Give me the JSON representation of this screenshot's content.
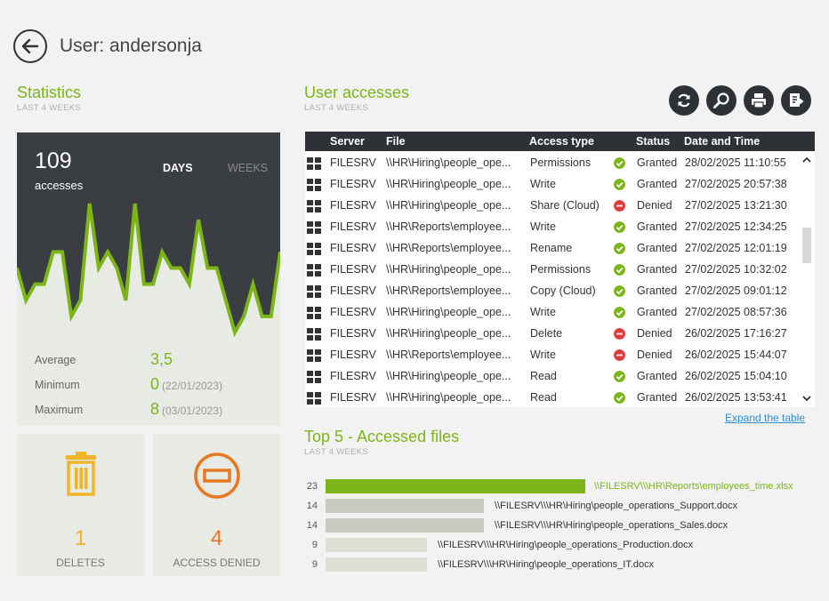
{
  "header": {
    "title": "User: andersonja"
  },
  "statistics": {
    "title": "Statistics",
    "subtitle": "LAST 4 WEEKS",
    "count": "109",
    "count_label": "accesses",
    "tab_days": "DAYS",
    "tab_weeks": "WEEKS",
    "average_label": "Average",
    "average_value": "3,5",
    "minimum_label": "Minimum",
    "minimum_value": "0",
    "minimum_date": "(22/01/2023)",
    "maximum_label": "Maximum",
    "maximum_value": "8",
    "maximum_date": "(03/01/2023)"
  },
  "kpis": {
    "deletes_value": "1",
    "deletes_label": "DELETES",
    "denied_value": "4",
    "denied_label": "ACCESS DENIED"
  },
  "accesses": {
    "title": "User accesses",
    "subtitle": "LAST 4 WEEKS",
    "columns": [
      "Server",
      "File",
      "Access type",
      "Status",
      "Date and Time"
    ],
    "rows": [
      {
        "server": "FILESRV",
        "file": "\\\\HR\\Hiring\\people_ope...",
        "type": "Permissions",
        "status": "Granted",
        "datetime": "28/02/2025 11:10:55"
      },
      {
        "server": "FILESRV",
        "file": "\\\\HR\\Hiring\\people_ope...",
        "type": "Write",
        "status": "Granted",
        "datetime": "27/02/2025 20:57:38"
      },
      {
        "server": "FILESRV",
        "file": "\\\\HR\\Hiring\\people_ope...",
        "type": "Share (Cloud)",
        "status": "Denied",
        "datetime": "27/02/2025 13:21:30"
      },
      {
        "server": "FILESRV",
        "file": "\\\\HR\\Reports\\employee...",
        "type": "Write",
        "status": "Granted",
        "datetime": "27/02/2025 12:34:25"
      },
      {
        "server": "FILESRV",
        "file": "\\\\HR\\Reports\\employee...",
        "type": "Rename",
        "status": "Granted",
        "datetime": "27/02/2025 12:01:19"
      },
      {
        "server": "FILESRV",
        "file": "\\\\HR\\Hiring\\people_ope...",
        "type": "Permissions",
        "status": "Granted",
        "datetime": "27/02/2025 10:32:02"
      },
      {
        "server": "FILESRV",
        "file": "\\\\HR\\Reports\\employee...",
        "type": "Copy (Cloud)",
        "status": "Granted",
        "datetime": "27/02/2025 09:01:12"
      },
      {
        "server": "FILESRV",
        "file": "\\\\HR\\Hiring\\people_ope...",
        "type": "Write",
        "status": "Granted",
        "datetime": "27/02/2025 08:57:36"
      },
      {
        "server": "FILESRV",
        "file": "\\\\HR\\Hiring\\people_ope...",
        "type": "Delete",
        "status": "Denied",
        "datetime": "26/02/2025 17:16:27"
      },
      {
        "server": "FILESRV",
        "file": "\\\\HR\\Reports\\employee...",
        "type": "Write",
        "status": "Denied",
        "datetime": "26/02/2025 15:44:07"
      },
      {
        "server": "FILESRV",
        "file": "\\\\HR\\Hiring\\people_ope...",
        "type": "Read",
        "status": "Granted",
        "datetime": "26/02/2025 15:04:10"
      },
      {
        "server": "FILESRV",
        "file": "\\\\HR\\Hiring\\people_ope...",
        "type": "Read",
        "status": "Granted",
        "datetime": "26/02/2025 13:53:41"
      }
    ],
    "expand_link": "Expand the table"
  },
  "top5": {
    "title": "Top 5 - Accessed files",
    "subtitle": "LAST 4 WEEKS",
    "items": [
      {
        "count": "23",
        "file": "\\\\FILESRV\\\\\\HR\\Reports\\employees_time.xlsx",
        "value": 23
      },
      {
        "count": "14",
        "file": "\\\\FILESRV\\\\\\HR\\Hiring\\people_operations_Support.docx",
        "value": 14
      },
      {
        "count": "14",
        "file": "\\\\FILESRV\\\\\\HR\\Hiring\\people_operations_Sales.docx",
        "value": 14
      },
      {
        "count": "9",
        "file": "\\\\FILESRV\\\\\\HR\\Hiring\\people_operations_Production.docx",
        "value": 9
      },
      {
        "count": "9",
        "file": "\\\\FILESRV\\\\\\HR\\Hiring\\people_operations_IT.docx",
        "value": 9
      }
    ]
  },
  "chart_data": {
    "type": "area",
    "series": [
      {
        "values": [
          4,
          2,
          3,
          3,
          5,
          5,
          1,
          2,
          8,
          4,
          5,
          4,
          2,
          8,
          3,
          3,
          5,
          4,
          4,
          3,
          7,
          4,
          4,
          2,
          0,
          1,
          3,
          1,
          1,
          5
        ]
      }
    ],
    "ylim": [
      0,
      8
    ]
  },
  "colors": {
    "accent": "#7cb518",
    "dark": "#2e3236",
    "denied": "#e03c3c",
    "deletes": "#f0b429",
    "access_denied": "#e87722"
  }
}
